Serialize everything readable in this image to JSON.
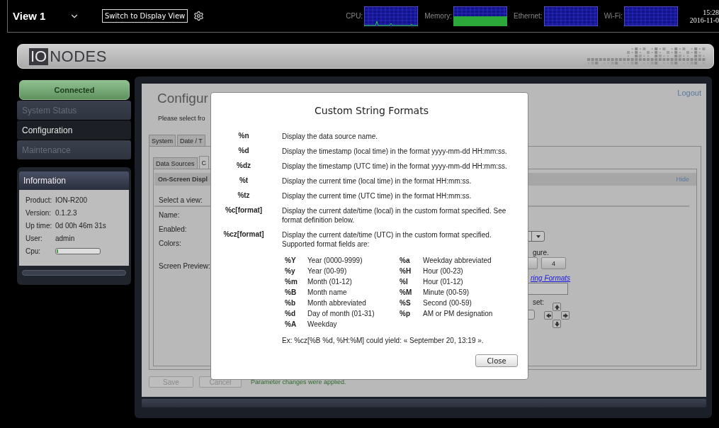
{
  "top_bar": {
    "view": "View 1",
    "switch_button": "Switch to Display View",
    "monitors": [
      {
        "label": "CPU:",
        "kind": "line"
      },
      {
        "label": "Memory:",
        "kind": "fill"
      },
      {
        "label": "Ethernet:",
        "kind": "empty"
      },
      {
        "label": "Wi-Fi:",
        "kind": "empty"
      }
    ],
    "time": "15:28",
    "date": "2016-11-0"
  },
  "logo": {
    "mark": "IO",
    "name": "NODES"
  },
  "sidebar": {
    "status": "Connected",
    "items": [
      {
        "label": "System Status",
        "selected": false
      },
      {
        "label": "Configuration",
        "selected": true
      },
      {
        "label": "Maintenance",
        "selected": false
      }
    ],
    "information": {
      "title": "Information",
      "rows": [
        {
          "label": "Product:",
          "value": "ION-R200"
        },
        {
          "label": "Version:",
          "value": "0.1.2.3"
        },
        {
          "label": "Up time:",
          "value": "0d 00h 46m 31s"
        },
        {
          "label": "User:",
          "value": "admin"
        },
        {
          "label": "Cpu:",
          "level": 0.03
        }
      ]
    }
  },
  "content": {
    "title": "Configur",
    "logout": "Logout",
    "intro": "Please select fro",
    "tabs": [
      {
        "label": "System",
        "selected": false
      },
      {
        "label": "Date / T",
        "selected": false
      }
    ],
    "subtabs": [
      {
        "label": "Data Sources",
        "selected": false
      },
      {
        "label": "C",
        "selected": true
      }
    ],
    "section": {
      "title": "On-Screen Displ",
      "toggle": "Hide",
      "labels": [
        "Select a view:",
        "Name:",
        "Enabled:",
        "Colors:",
        "Screen Preview:"
      ],
      "hint": "gure.",
      "number_button": "4",
      "link": "ring Formats",
      "offset_label": "set:"
    },
    "buttons": [
      {
        "label": "Save",
        "disabled": true
      },
      {
        "label": "Cancel",
        "disabled": true
      }
    ],
    "message": "Parameter changes were applied."
  },
  "dialog": {
    "title": "Custom String Formats",
    "entries": [
      {
        "code": "%n",
        "text": "Display the data source name."
      },
      {
        "code": "%d",
        "text": "Display the timestamp (local time) in the format yyyy-mm-dd HH:mm:ss."
      },
      {
        "code": "%dz",
        "text": "Display the timestamp (UTC time) in the format yyyy-mm-dd HH:mm:ss."
      },
      {
        "code": "%t",
        "text": "Display the current time (local time) in the format HH:mm:ss."
      },
      {
        "code": "%tz",
        "text": "Display the current time (UTC time) in the format HH:mm:ss."
      },
      {
        "code": "%c[format]",
        "text": "Display the current date/time (local) in the custom format specified.  See format definition below."
      },
      {
        "code": "%cz[format]",
        "text": "Display the current date/time (UTC) in the custom format specified. Supported format fields are:"
      }
    ],
    "fields": [
      {
        "code": "%Y",
        "text": "Year (0000-9999)"
      },
      {
        "code": "%a",
        "text": "Weekday abbreviated"
      },
      {
        "code": "%y",
        "text": "Year (00-99)"
      },
      {
        "code": "%H",
        "text": "Hour (00-23)"
      },
      {
        "code": "%m",
        "text": "Month (01-12)"
      },
      {
        "code": "%I",
        "text": "Hour (01-12)"
      },
      {
        "code": "%B",
        "text": "Month name"
      },
      {
        "code": "%M",
        "text": "Minute (00-59)"
      },
      {
        "code": "%b",
        "text": "Month abbreviated"
      },
      {
        "code": "%S",
        "text": "Second (00-59)"
      },
      {
        "code": "%d",
        "text": "Day of month (01-31)"
      },
      {
        "code": "%p",
        "text": "AM or PM designation"
      },
      {
        "code": "%A",
        "text": "Weekday"
      }
    ],
    "example": "Ex: %cz[%B %d, %H:%M] could yield: « September 20, 13:19 ».",
    "close": "Close"
  }
}
